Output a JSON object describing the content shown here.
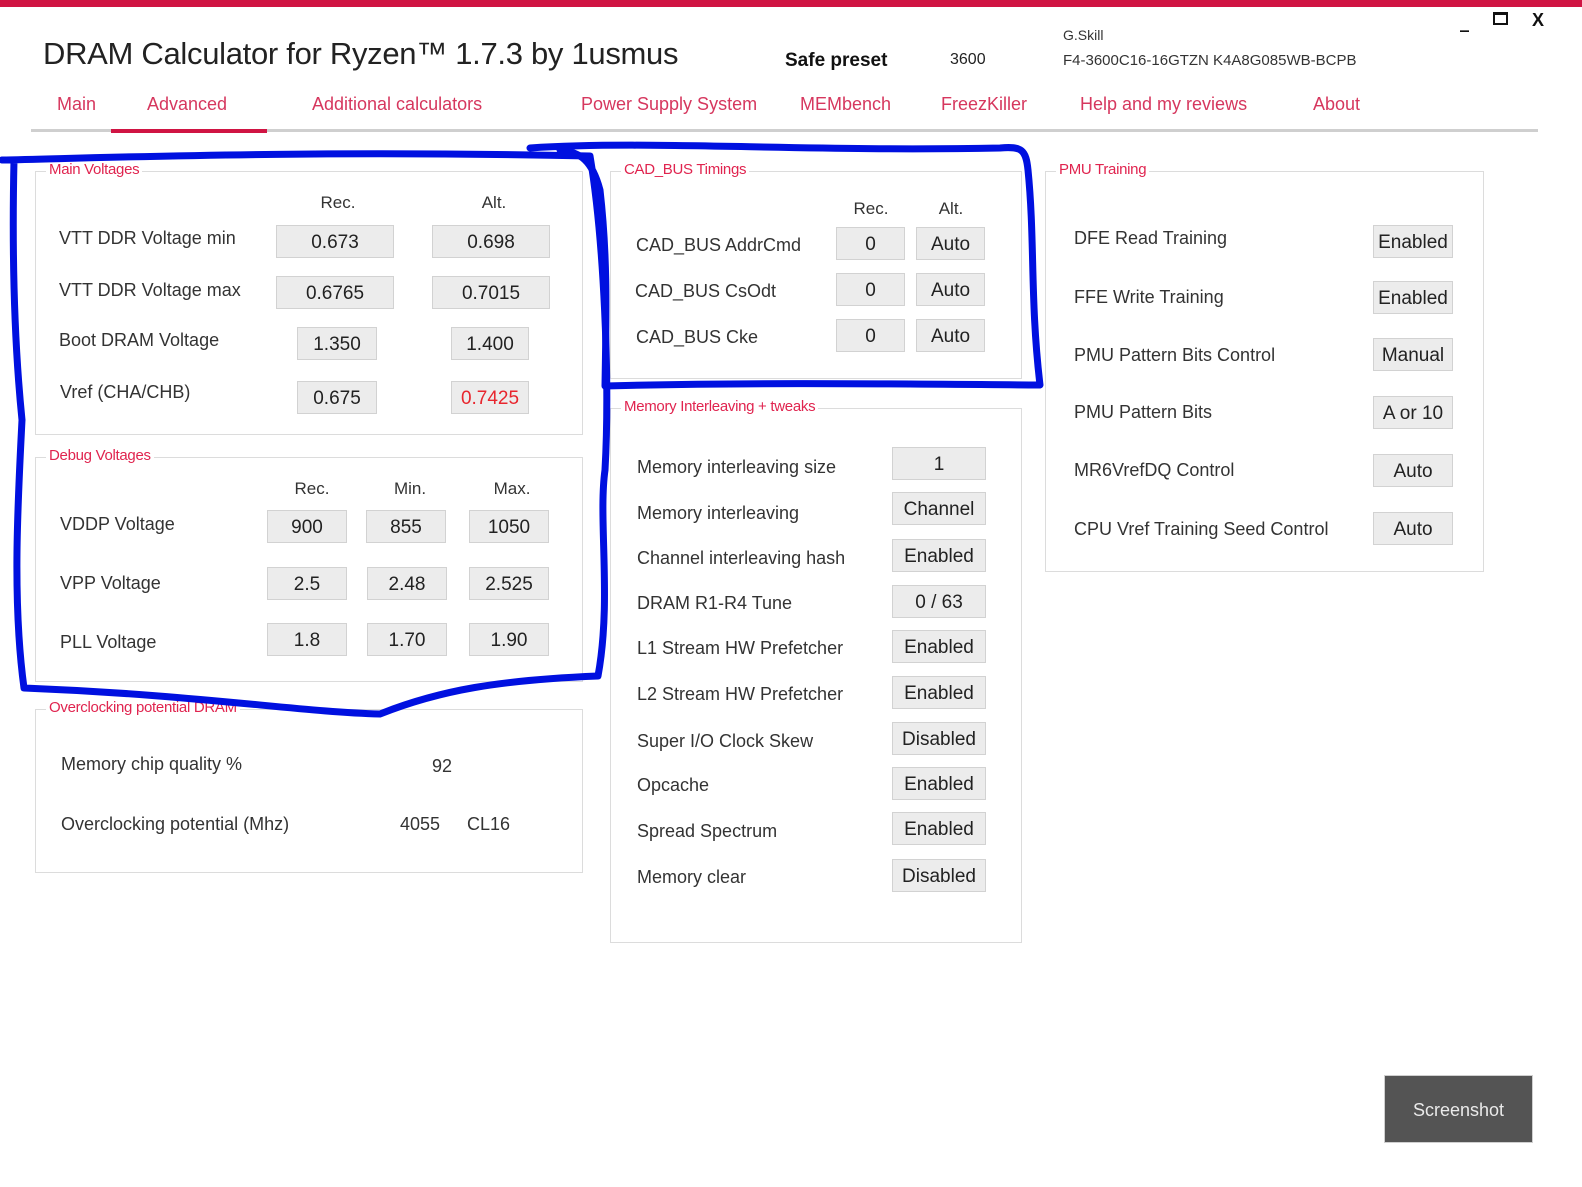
{
  "window": {
    "title": "DRAM Calculator for Ryzen™ 1.7.3 by 1usmus",
    "preset": "Safe preset",
    "frequency": "3600",
    "vendor": "G.Skill",
    "part_number": "F4-3600C16-16GTZN K4A8G085WB-BCPB",
    "controls": {
      "minimize": "_",
      "close": "X"
    },
    "accent_color": "#d01443"
  },
  "nav": {
    "active": "Advanced",
    "items": [
      {
        "label": "Main"
      },
      {
        "label": "Advanced"
      },
      {
        "label": "Additional calculators"
      },
      {
        "label": "Power Supply System"
      },
      {
        "label": "MEMbench"
      },
      {
        "label": "FreezKiller"
      },
      {
        "label": "Help and my reviews"
      },
      {
        "label": "About"
      }
    ]
  },
  "main_voltages": {
    "title": "Main Voltages",
    "col_rec": "Rec.",
    "col_alt": "Alt.",
    "rows": [
      {
        "label": "VTT DDR Voltage min",
        "rec": "0.673",
        "alt": "0.698"
      },
      {
        "label": "VTT DDR Voltage max",
        "rec": "0.6765",
        "alt": "0.7015"
      },
      {
        "label": "Boot DRAM Voltage",
        "rec": "1.350",
        "alt": "1.400"
      },
      {
        "label": "Vref (CHA/CHB)",
        "rec": "0.675",
        "alt": "0.7425"
      }
    ],
    "highlight_color": "#e8262e"
  },
  "debug_voltages": {
    "title": "Debug Voltages",
    "col_rec": "Rec.",
    "col_min": "Min.",
    "col_max": "Max.",
    "rows": [
      {
        "label": "VDDP Voltage",
        "rec": "900",
        "min": "855",
        "max": "1050"
      },
      {
        "label": "VPP Voltage",
        "rec": "2.5",
        "min": "2.48",
        "max": "2.525"
      },
      {
        "label": "PLL Voltage",
        "rec": "1.8",
        "min": "1.70",
        "max": "1.90"
      }
    ]
  },
  "oc_potential": {
    "title": "Overclocking potential DRAM",
    "quality_label": "Memory chip quality %",
    "quality_value": "92",
    "potential_label": "Overclocking potential (Mhz)",
    "potential_value": "4055",
    "potential_cl": "CL16"
  },
  "cad_bus": {
    "title": "CAD_BUS Timings",
    "col_rec": "Rec.",
    "col_alt": "Alt.",
    "rows": [
      {
        "label": "CAD_BUS AddrCmd",
        "rec": "0",
        "alt": "Auto"
      },
      {
        "label": "CAD_BUS CsOdt",
        "rec": "0",
        "alt": "Auto"
      },
      {
        "label": "CAD_BUS Cke",
        "rec": "0",
        "alt": "Auto"
      }
    ]
  },
  "interleaving": {
    "title": "Memory Interleaving + tweaks",
    "rows": [
      {
        "label": "Memory interleaving size",
        "value": "1"
      },
      {
        "label": "Memory interleaving",
        "value": "Channel"
      },
      {
        "label": "Channel interleaving hash",
        "value": "Enabled"
      },
      {
        "label": "DRAM R1-R4 Tune",
        "value": "0 / 63"
      },
      {
        "label": "L1 Stream HW Prefetcher",
        "value": "Enabled"
      },
      {
        "label": "L2 Stream HW Prefetcher",
        "value": "Enabled"
      },
      {
        "label": "Super I/O Clock Skew",
        "value": "Disabled"
      },
      {
        "label": "Opcache",
        "value": "Enabled"
      },
      {
        "label": "Spread Spectrum",
        "value": "Enabled"
      },
      {
        "label": "Memory clear",
        "value": "Disabled"
      }
    ]
  },
  "pmu_training": {
    "title": "PMU Training",
    "rows": [
      {
        "label": "DFE Read Training",
        "value": "Enabled"
      },
      {
        "label": "FFE Write Training",
        "value": "Enabled"
      },
      {
        "label": "PMU Pattern Bits Control",
        "value": "Manual"
      },
      {
        "label": "PMU Pattern Bits",
        "value": "A or 10"
      },
      {
        "label": "MR6VrefDQ Control",
        "value": "Auto"
      },
      {
        "label": "CPU Vref Training Seed Control",
        "value": "Auto"
      }
    ]
  },
  "footer": {
    "screenshot_label": "Screenshot"
  },
  "annotation": {
    "color": "#0010e0"
  }
}
